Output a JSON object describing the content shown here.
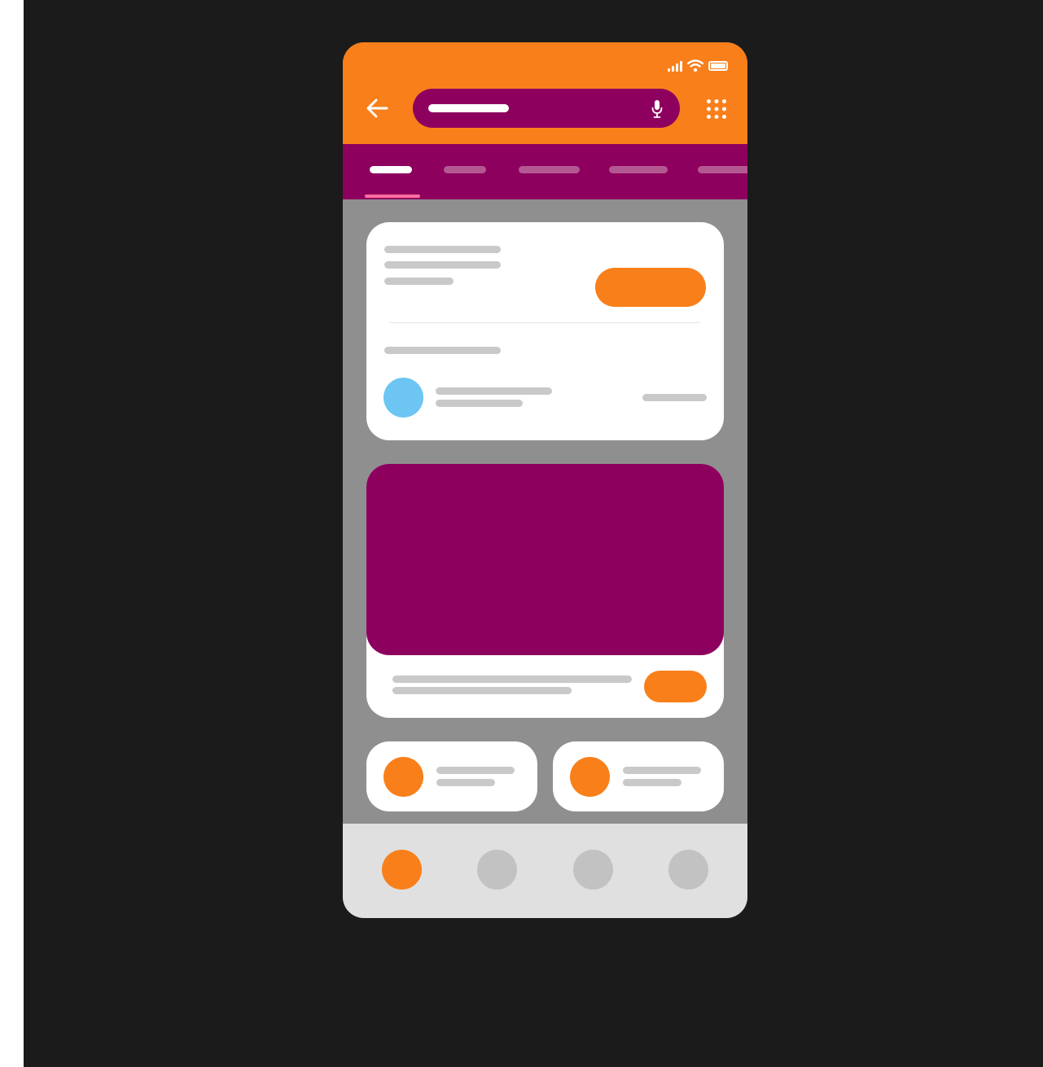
{
  "colors": {
    "accent_orange": "#f97f1a",
    "brand_purple": "#8e005e",
    "tab_indicator": "#ff6fa0",
    "avatar_blue": "#6cc5f2",
    "content_bg": "#8f8f8f",
    "skeleton": "#c9c9c9",
    "nav_bg": "#e0e0e0",
    "nav_inactive": "#c2c2c2"
  },
  "status_bar": {
    "icons": [
      "signal-icon",
      "wifi-icon",
      "battery-icon"
    ]
  },
  "app_bar": {
    "back_icon": "arrow-left-icon",
    "search": {
      "query": "",
      "placeholder": "",
      "mic_icon": "microphone-icon"
    },
    "menu_icon": "apps-grid-icon"
  },
  "tabs": {
    "items": [
      "",
      "",
      "",
      "",
      ""
    ],
    "selected_index": 0
  },
  "bottom_nav": {
    "items": [
      "",
      "",
      "",
      ""
    ],
    "selected_index": 0
  }
}
